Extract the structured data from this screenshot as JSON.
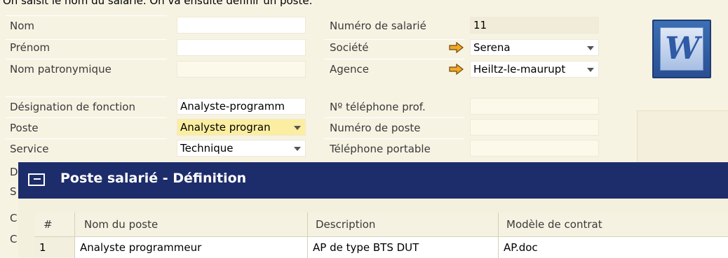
{
  "top_text": "On saisit le nom du salarié. On va ensuite définir un poste.",
  "form": {
    "nom": {
      "label": "Nom",
      "value": ""
    },
    "prenom": {
      "label": "Prénom",
      "value": ""
    },
    "nom_patronymique": {
      "label": "Nom patronymique",
      "value": ""
    },
    "designation_fonction": {
      "label": "Désignation de fonction",
      "value": "Analyste-programm"
    },
    "poste": {
      "label": "Poste",
      "value": "Analyste progran"
    },
    "service": {
      "label": "Service",
      "value": "Technique"
    },
    "numero_salarie": {
      "label": "Numéro de salarié",
      "value": "11"
    },
    "societe": {
      "label": "Société",
      "value": "Serena"
    },
    "agence": {
      "label": "Agence",
      "value": "Heiltz-le-maurupt"
    },
    "tel_prof": {
      "label": "Nº téléphone prof.",
      "value": ""
    },
    "numero_poste": {
      "label": "Numéro de poste",
      "value": ""
    },
    "tel_portable": {
      "label": "Téléphone portable",
      "value": ""
    }
  },
  "left_stubs": [
    "D",
    "S",
    "C",
    "C"
  ],
  "modal": {
    "title": "Poste salarié - Définition",
    "table": {
      "headers": [
        "#",
        "Nom du poste",
        "Description",
        "Modèle de contrat"
      ],
      "rows": [
        [
          "1",
          "Analyste programmeur",
          "AP de type BTS  DUT",
          "AP.doc"
        ]
      ]
    }
  },
  "icons": {
    "word": "word-document-icon",
    "link_arrow": "orange-link-arrow-icon"
  },
  "colors": {
    "modal_title_bg": "#1d2d6b",
    "highlight_field": "#fbeea0",
    "link_arrow": "#f5a623"
  }
}
